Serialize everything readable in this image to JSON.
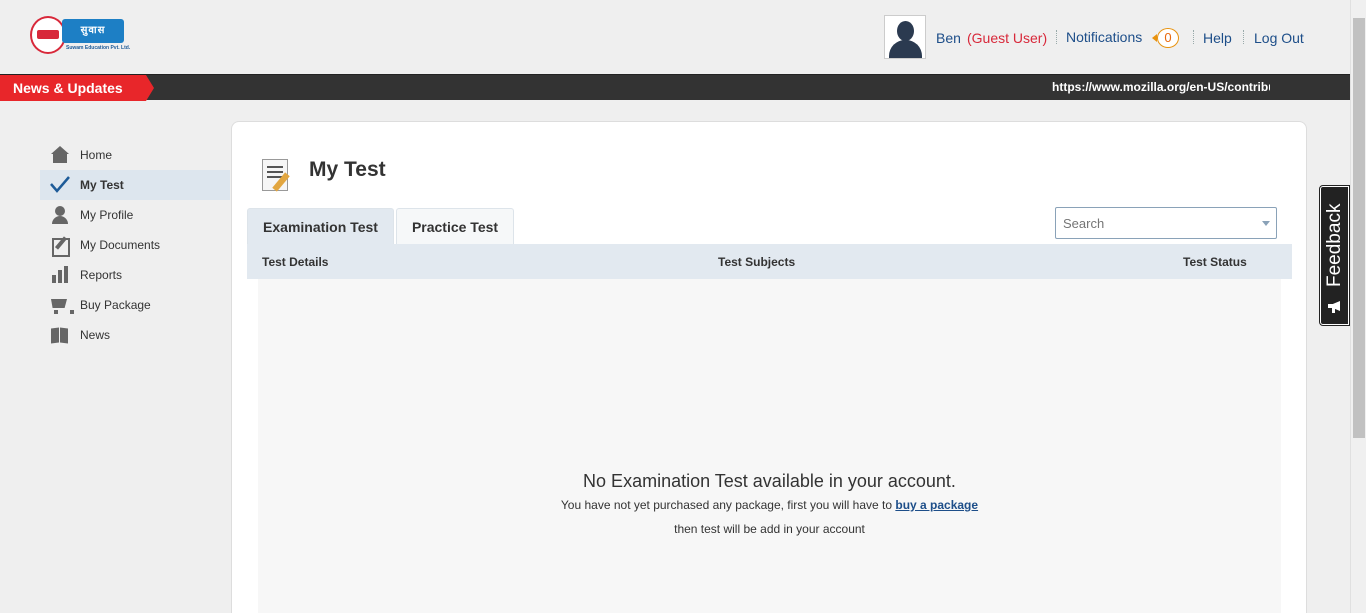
{
  "header": {
    "logo": {
      "word": "सुवास",
      "subtitle": "Suwam Education Pvt. Ltd."
    },
    "user": {
      "name": "Ben",
      "role": "(Guest User)"
    },
    "notifications": {
      "label": "Notifications",
      "count": "0"
    },
    "help_label": "Help",
    "logout_label": "Log Out"
  },
  "newsbar": {
    "label": "News & Updates",
    "ticker": "https://www.mozilla.org/en-US/contribute/"
  },
  "sidebar": {
    "items": [
      {
        "label": "Home",
        "icon": "home-icon"
      },
      {
        "label": "My Test",
        "icon": "checkmark-icon",
        "active": true
      },
      {
        "label": "My Profile",
        "icon": "user-icon"
      },
      {
        "label": "My Documents",
        "icon": "edit-document-icon"
      },
      {
        "label": "Reports",
        "icon": "bar-chart-icon"
      },
      {
        "label": "Buy Package",
        "icon": "cart-icon"
      },
      {
        "label": "News",
        "icon": "book-icon"
      }
    ]
  },
  "main": {
    "title": "My Test",
    "tabs": [
      {
        "label": "Examination Test",
        "active": true
      },
      {
        "label": "Practice Test",
        "active": false
      }
    ],
    "search": {
      "placeholder": "Search"
    },
    "table": {
      "columns": [
        "Test Details",
        "Test Subjects",
        "Test Status"
      ]
    },
    "empty": {
      "title": "No Examination Test available in your account.",
      "line1_prefix": "You have not yet purchased any package, first you will have to",
      "line1_link": "buy a package",
      "line2": "then test will be add in your account"
    }
  },
  "feedback": {
    "label": "Feedback"
  },
  "colors": {
    "accent_red": "#e8262a",
    "link_blue": "#1d4e89",
    "news_bar": "#333333",
    "tab_active": "#e2e9f0",
    "notif_orange": "#e8920e"
  }
}
